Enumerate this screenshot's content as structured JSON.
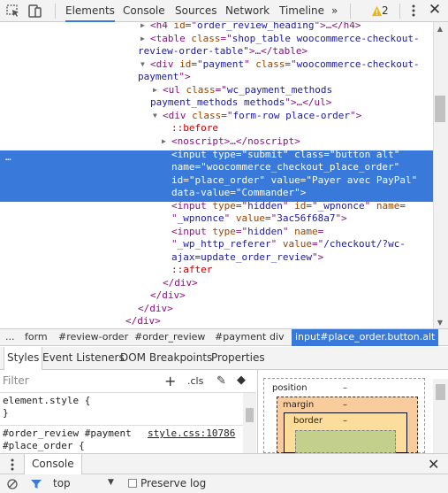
{
  "toolbar": {
    "tabs": [
      "Elements",
      "Console",
      "Sources",
      "Network",
      "Timeline"
    ],
    "active_tab": "Elements",
    "more": "»",
    "warning_count": "2",
    "close": "✕"
  },
  "dom": {
    "lines": [
      [
        [
          "tn",
          "<h4 "
        ],
        [
          "an",
          "id"
        ],
        [
          "tn",
          "=\""
        ],
        [
          "av",
          "order_review_heading"
        ],
        [
          "tn",
          "\">"
        ],
        [
          "pn",
          "…"
        ],
        [
          "tn",
          "</h4>"
        ]
      ],
      [
        [
          "tn",
          "<table "
        ],
        [
          "an",
          "class"
        ],
        [
          "tn",
          "=\""
        ],
        [
          "av",
          "shop_table woocommerce-checkout-"
        ]
      ],
      [
        [
          "av",
          "review-order-table"
        ],
        [
          "tn",
          "\">"
        ],
        [
          "pn",
          "…"
        ],
        [
          "tn",
          "</table>"
        ]
      ],
      [
        [
          "tn",
          "<div "
        ],
        [
          "an",
          "id"
        ],
        [
          "tn",
          "=\""
        ],
        [
          "av",
          "payment"
        ],
        [
          "tn",
          "\" "
        ],
        [
          "an",
          "class"
        ],
        [
          "tn",
          "=\""
        ],
        [
          "av",
          "woocommerce-checkout-"
        ]
      ],
      [
        [
          "av",
          "payment"
        ],
        [
          "tn",
          "\">"
        ]
      ],
      [
        [
          "tn",
          "<ul "
        ],
        [
          "an",
          "class"
        ],
        [
          "tn",
          "=\""
        ],
        [
          "av",
          "wc_payment_methods"
        ]
      ],
      [
        [
          "av",
          "payment_methods methods"
        ],
        [
          "tn",
          "\">"
        ],
        [
          "pn",
          "…"
        ],
        [
          "tn",
          "</ul>"
        ]
      ],
      [
        [
          "tn",
          "<div "
        ],
        [
          "an",
          "class"
        ],
        [
          "tn",
          "=\""
        ],
        [
          "av",
          "form-row place-order"
        ],
        [
          "tn",
          "\">"
        ]
      ],
      [
        [
          "ps",
          "::before"
        ]
      ],
      [
        [
          "tn",
          "<noscript>"
        ],
        [
          "pn",
          "…"
        ],
        [
          "tn",
          "</noscript>"
        ]
      ],
      [
        [
          "tn",
          "<input "
        ],
        [
          "an",
          "type"
        ],
        [
          "tn",
          "=\""
        ],
        [
          "av",
          "submit"
        ],
        [
          "tn",
          "\" "
        ],
        [
          "an",
          "class"
        ],
        [
          "tn",
          "=\""
        ],
        [
          "av",
          "button alt"
        ],
        [
          "tn",
          "\""
        ]
      ],
      [
        [
          "an",
          "name"
        ],
        [
          "tn",
          "=\""
        ],
        [
          "av",
          "woocommerce_checkout_place_order"
        ],
        [
          "tn",
          "\""
        ]
      ],
      [
        [
          "an",
          "id"
        ],
        [
          "tn",
          "=\""
        ],
        [
          "av",
          "place_order"
        ],
        [
          "tn",
          "\" "
        ],
        [
          "an",
          "value"
        ],
        [
          "tn",
          "=\""
        ],
        [
          "av",
          "Payer avec PayPal"
        ],
        [
          "tn",
          "\""
        ]
      ],
      [
        [
          "an",
          "data-value"
        ],
        [
          "tn",
          "=\""
        ],
        [
          "av",
          "Commander"
        ],
        [
          "tn",
          "\">"
        ]
      ],
      [
        [
          "tn",
          "<input "
        ],
        [
          "an",
          "type"
        ],
        [
          "tn",
          "=\""
        ],
        [
          "av",
          "hidden"
        ],
        [
          "tn",
          "\" "
        ],
        [
          "an",
          "id"
        ],
        [
          "tn",
          "=\""
        ],
        [
          "av",
          "_wpnonce"
        ],
        [
          "tn",
          "\" "
        ],
        [
          "an",
          "name"
        ],
        [
          "tn",
          "="
        ]
      ],
      [
        [
          "tn",
          "\""
        ],
        [
          "av",
          "_wpnonce"
        ],
        [
          "tn",
          "\" "
        ],
        [
          "an",
          "value"
        ],
        [
          "tn",
          "=\""
        ],
        [
          "av",
          "3ac56f68a7"
        ],
        [
          "tn",
          "\">"
        ]
      ],
      [
        [
          "tn",
          "<input "
        ],
        [
          "an",
          "type"
        ],
        [
          "tn",
          "=\""
        ],
        [
          "av",
          "hidden"
        ],
        [
          "tn",
          "\" "
        ],
        [
          "an",
          "name"
        ],
        [
          "tn",
          "="
        ]
      ],
      [
        [
          "tn",
          "\""
        ],
        [
          "av",
          "_wp_http_referer"
        ],
        [
          "tn",
          "\" "
        ],
        [
          "an",
          "value"
        ],
        [
          "tn",
          "=\""
        ],
        [
          "av",
          "/checkout/?wc-"
        ]
      ],
      [
        [
          "av",
          "ajax=update_order_review"
        ],
        [
          "tn",
          "\">"
        ]
      ],
      [
        [
          "ps",
          "::after"
        ]
      ],
      [
        [
          "tn",
          "</div>"
        ]
      ],
      [
        [
          "tn",
          "</div>"
        ]
      ],
      [
        [
          "tn",
          "</div>"
        ]
      ],
      [
        [
          "tn",
          "</div>"
        ]
      ]
    ],
    "selected_ellipsis": "…"
  },
  "breadcrumb": [
    "...",
    "form",
    "#review-order",
    "#order_review",
    "#payment",
    "div",
    "input#place_order.button.alt"
  ],
  "subtabs": [
    "Styles",
    "Event Listeners",
    "DOM Breakpoints",
    "Properties"
  ],
  "styles": {
    "filter_placeholder": "Filter",
    "plus": "+",
    "cls": ".cls",
    "rule1_selector": "element.style {",
    "rule1_close": "}",
    "rule2_selector": "#order_review #payment",
    "rule2_selector_cont": "#place_order {",
    "rule2_source": "style.css:10786"
  },
  "box_model": {
    "position_label": "position",
    "position_value": "–",
    "margin_label": "margin",
    "margin_value": "–",
    "border_label": "border",
    "border_value": "–"
  },
  "drawer": {
    "tab": "Console",
    "close": "✕",
    "context": "top",
    "preserve_log": "Preserve log"
  }
}
